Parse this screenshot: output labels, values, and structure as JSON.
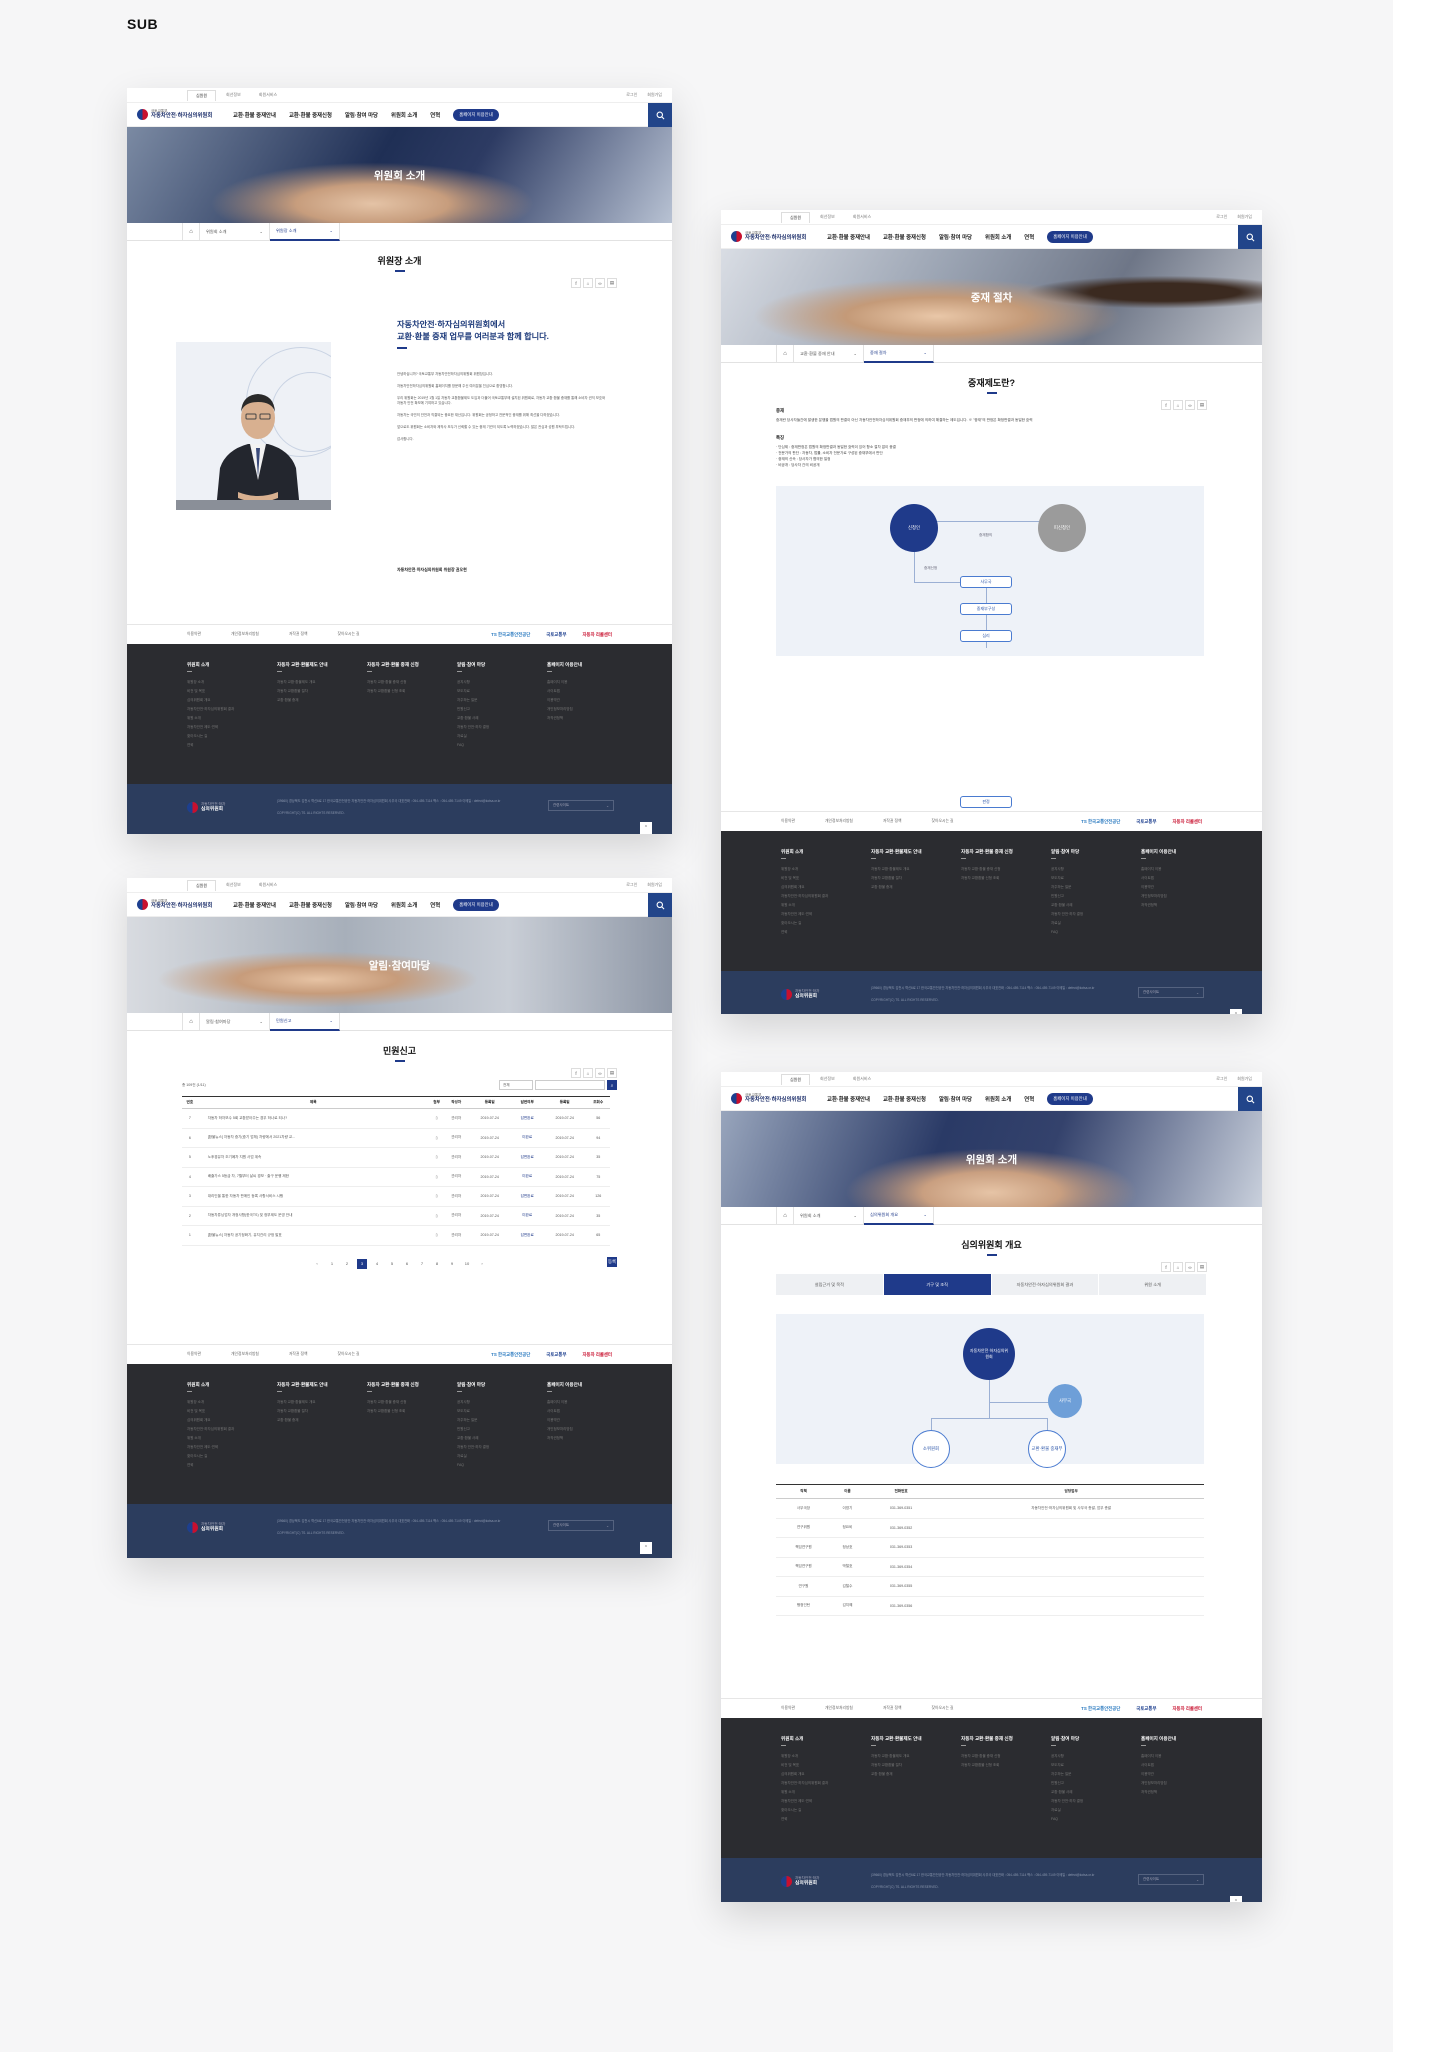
{
  "section_label": "SUB",
  "common": {
    "util_tabs": [
      "심원원",
      "회선정보",
      "회원서비스"
    ],
    "util_right": [
      "로그인",
      "회원가입"
    ],
    "logo_line1": "국토교통부",
    "logo_line2": "자동차안전·하자심의위원회",
    "menu": [
      "교환·환불 중재안내",
      "교환·환불 중재신청",
      "알림·참여 마당",
      "위원회 소개",
      "연혁"
    ],
    "gnb_button": "홈페이지 이용안내",
    "footer_sites": [
      "이용약관",
      "개인정보처리방침",
      "저작권 정책",
      "찾아오시는 길"
    ],
    "footer_logos": [
      "TS 한국교통안전공단",
      "국토교통부",
      "자동차 리콜센터"
    ],
    "footer_menu": [
      {
        "title": "위원회 소개",
        "items": [
          "위원장 소개",
          "비전 및 목표",
          "심의위원회 개요",
          "자동차안전·하자심의위원회 결과",
          "위원 소개",
          "자동차안전 제도·연혁",
          "찾아오시는 길",
          "연혁"
        ]
      },
      {
        "title": "자동차 교환·환불제도 안내",
        "items": [
          "자동차 교환·환불제도 개요",
          "자동차 교환환불 절차",
          "교환·환불 중재"
        ]
      },
      {
        "title": "자동차 교환·환불 중재 신청",
        "items": [
          "자동차 교환·환불 중재 신청",
          "자동차 교환환불 신청 조회"
        ]
      },
      {
        "title": "알림·참여 마당",
        "items": [
          "공지사항",
          "보도자료",
          "자주하는 질문",
          "민원신고",
          "교환·환불 사례",
          "자동차 안전·하자 결정",
          "자료실",
          "FAQ"
        ]
      },
      {
        "title": "홈페이지 이용안내",
        "items": [
          "홈페이지 이용",
          "사이트맵",
          "이용약관",
          "개인정보처리방침",
          "저작권정책"
        ]
      }
    ],
    "footer_logo_line1": "자동차안전·하자",
    "footer_logo_line2": "심의위원회",
    "footer_address": "(39660) 경상북도 김천시 혁신6로 17 한국교통안전공단 자동차안전·하자심의위원회 사무국 대표전화 : 054-459-7114  팩스 : 054-459-7149  이메일 : defect@kotsa.or.kr",
    "footer_copyright": "COPYRIGHT(C) TS. ALL RIGHTS RESERVED.",
    "footer_select": "관련사이트",
    "top_button": "TOP"
  },
  "screen1": {
    "banner_title": "위원회 소개",
    "crumb": [
      "위원회 소개",
      "위원장 소개"
    ],
    "page_title": "위원장 소개",
    "greeting": [
      "자동차안전·하자심의위원회에서",
      "교환·환불 중재 업무를 여러분과 함께 합니다."
    ],
    "paragraphs": [
      "안녕하십니까? 국토교통부 자동차안전하자심의위원회 위원장입니다.",
      "자동차안전하자심의위원회 홈페이지를 방문해 주신 여러분을 진심으로 환영합니다.",
      "우리 위원회는 2019년 1월 1일 자동차 교환환불제도 도입과 더불어 국토교통부에 설치된 위원회로, 자동차 교환·환불 중재를 통해 소비자 권익 보호와 자동차 안전 확보에 기여하고 있습니다.",
      "자동차는 국민의 안전과 직결되는 중요한 재산입니다. 위원회는 공정하고 전문적인 중재를 위해 최선을 다하겠습니다.",
      "앞으로도 위원회는 소비자와 제작사 모두가 신뢰할 수 있는 중재 기관이 되도록 노력하겠습니다. 많은 관심과 성원 부탁드립니다.",
      "감사합니다."
    ],
    "signature": "자동차안전·하자심의위원회 위원장 권오현"
  },
  "screen2": {
    "banner_title": "중재 절차",
    "crumb": [
      "교환·환불 중재 안내",
      "중재 절차"
    ],
    "page_title": "중재제도란?",
    "sec1_title": "중재",
    "sec1_text": "중재란 당사자들간에 발생한 분쟁을 법원의 판결이 아닌 자동차안전하자심의위원회 중재부의 판정에 의하여 해결하는 제도입니다. ※ \"중재\"의 판정은 확정판결과 동일한 효력",
    "sec2_title": "특징",
    "sec2_items": [
      "· 단심제 : 중재판정은 법원의 확정판결과 동일한 효력이 있어 항소 절차 없이 종결",
      "· 전문가의 판단 : 자동차, 법률, 소비자 전문가로 구성된 중재부에서 판단",
      "· 중재의 신속 : 당사자가 협의한 일정",
      "· 비공개 : 당사자 간의 비공개"
    ],
    "nodes": {
      "applicant": "신청인",
      "respondent": "피신청인",
      "request_label": "중재합의",
      "apply_label": "중재신청",
      "office": "사무국",
      "panel": "중재부구성",
      "hearing": "심리",
      "award": "판정"
    }
  },
  "screen3": {
    "banner_title": "알림·참여마당",
    "crumb": [
      "알림·참여마당",
      "민원신고"
    ],
    "page_title": "민원신고",
    "total_label": "총 109건 (1/11)",
    "search_select": "전체",
    "columns": [
      "번호",
      "제목",
      "첨부",
      "작성자",
      "등록일",
      "답변여부",
      "등록일",
      "조회수"
    ],
    "rows": [
      {
        "no": "7",
        "title": "자동차 하자보수 5회 교환받아주는 경우 하나로 되나?",
        "author": "관리자",
        "date": "2019-07-24",
        "status": "답변완료",
        "date2": "2019-07-24",
        "views": "56"
      },
      {
        "no": "6",
        "title": "[환불뉴스] 자동차 중기(중기 업체) 차량에서 2021차량 교...",
        "author": "관리자",
        "date": "2019-07-24",
        "status": "미완료",
        "date2": "2019-07-24",
        "views": "94"
      },
      {
        "no": "5",
        "title": "노후경유차 조기폐차 지원 사업 계속",
        "author": "관리자",
        "date": "2019-07-24",
        "status": "답변완료",
        "date2": "2019-07-24",
        "views": "35"
      },
      {
        "no": "4",
        "title": "배출가스 5등급 차, 7월부터 날씨 경보 · 출구 운행 제한",
        "author": "관리자",
        "date": "2019-07-24",
        "status": "미완료",
        "date2": "2019-07-24",
        "views": "75"
      },
      {
        "no": "3",
        "title": "대리인을 통한 자동차 판매인 등록 사항서비스 시행",
        "author": "관리자",
        "date": "2019-07-24",
        "status": "답변완료",
        "date2": "2019-07-24",
        "views": "126"
      },
      {
        "no": "2",
        "title": "자동차튜닝업자 개정사항(한국TS) 및 정부제도 운영 안내",
        "author": "관리자",
        "date": "2019-07-24",
        "status": "미완료",
        "date2": "2019-07-24",
        "views": "35"
      },
      {
        "no": "1",
        "title": "[환불뉴스] 자동차 공기정화기, 유지관리 규정 발표",
        "author": "관리자",
        "date": "2019-07-24",
        "status": "답변완료",
        "date2": "2019-07-24",
        "views": "65"
      }
    ],
    "pages": [
      "‹",
      "1",
      "2",
      "3",
      "4",
      "5",
      "6",
      "7",
      "8",
      "9",
      "10",
      "›"
    ],
    "current_page": "3",
    "write_button": "등록"
  },
  "screen4": {
    "banner_title": "위원회 소개",
    "crumb": [
      "위원회 소개",
      "심의위원회 개요"
    ],
    "page_title": "심의위원회 개요",
    "tabs": [
      "설립근거 및 목적",
      "기구 및 조직",
      "자동차안전·하자심의위원회 결과",
      "위원 소개"
    ],
    "active_tab": "기구 및 조직",
    "org": {
      "top": "자동차안전·하자심의위원회",
      "office": "사무국",
      "left": "소위원회",
      "right": "교환·환불 중재부"
    },
    "columns": [
      "직책",
      "이름",
      "전화번호",
      "담당업무"
    ],
    "rows": [
      {
        "role": "사무국장",
        "name": "이영기",
        "phone": "031-369-0351",
        "duty": "자동차안전·하자심의위원회 및 사무국 총괄, 업무 총괄"
      },
      {
        "role": "연구위원",
        "name": "정요비",
        "phone": "031-369-0352",
        "duty": ""
      },
      {
        "role": "책임연구원",
        "name": "정상호",
        "phone": "031-369-0353",
        "duty": ""
      },
      {
        "role": "책임연구원",
        "name": "박철호",
        "phone": "031-369-0354",
        "duty": ""
      },
      {
        "role": "연구원",
        "name": "김철수",
        "phone": "031-369-0355",
        "duty": ""
      },
      {
        "role": "행정인턴",
        "name": "김지혜",
        "phone": "031-369-0356",
        "duty": ""
      }
    ]
  }
}
